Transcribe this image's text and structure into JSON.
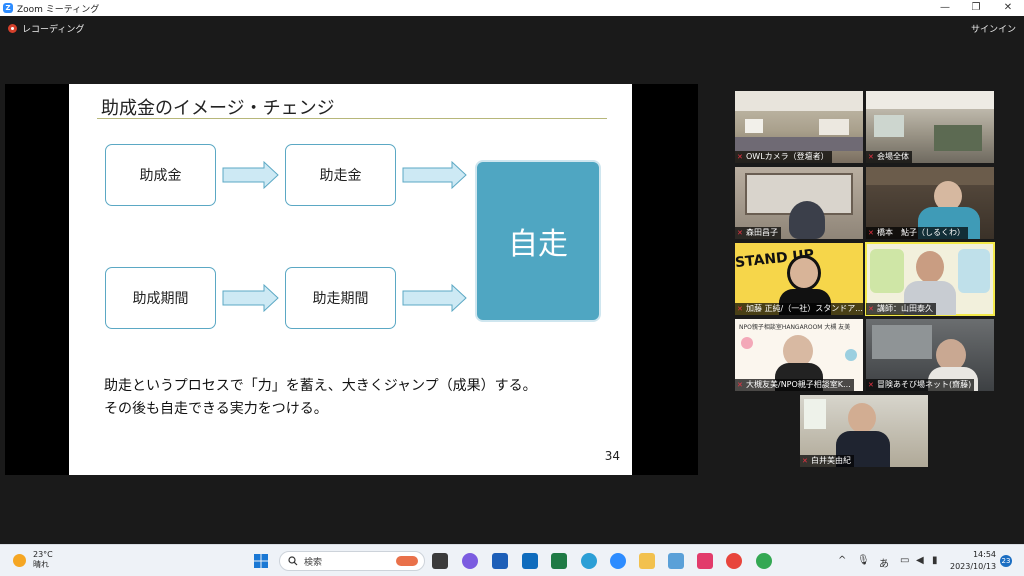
{
  "window": {
    "title": "Zoom ミーティング",
    "min": "—",
    "restore": "❐",
    "close": "✕"
  },
  "topbar": {
    "recording": "レコーディング",
    "signin": "サインイン"
  },
  "slide": {
    "title": "助成金のイメージ・チェンジ",
    "box1": "助成金",
    "box2": "助走金",
    "box3": "助成期間",
    "box4": "助走期間",
    "big": "自走",
    "line1": "助走というプロセスで「力」を蓄え、大きくジャンプ（成果）する。",
    "line2": "その後も自走できる実力をつける。",
    "page": "34"
  },
  "participants": [
    {
      "name": "OWLカメラ（登壇者）"
    },
    {
      "name": "会場全体"
    },
    {
      "name": "森田昌子"
    },
    {
      "name": "橋本　鮎子（しるくわ）"
    },
    {
      "name": "加藤 正純/（一社）スタンドア..."
    },
    {
      "name": "講師：山田泰久"
    },
    {
      "name": "大槻友美/NPO親子相談室K..."
    },
    {
      "name": "冒険あそび場ネット(齋藤)"
    },
    {
      "name": "白井美由紀"
    }
  ],
  "tile_texts": {
    "stand": "STAND UP",
    "npo_banner": "NPO親子相談室HANGAROOM 大槻 友美"
  },
  "taskbar": {
    "temp": "23°C",
    "weather": "晴れ",
    "search": "検索",
    "time": "14:54",
    "date": "2023/10/13",
    "notifications": "23",
    "ime": "あ",
    "chevron": "^"
  },
  "colors": {
    "accent": "#4fa6c2",
    "zoom_blue": "#2d8cff",
    "active_speaker": "#f3e94a"
  }
}
